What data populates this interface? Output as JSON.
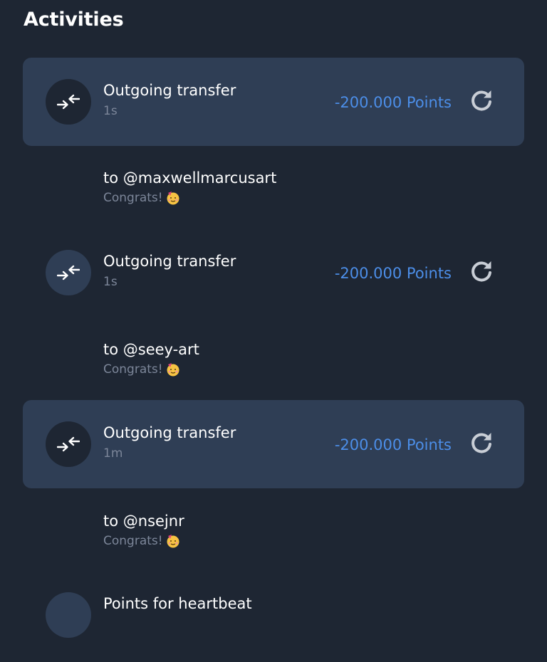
{
  "header": {
    "title": "Activities"
  },
  "activities": [
    {
      "title": "Outgoing transfer",
      "time": "1s",
      "amount": "-200.000 Points",
      "to": "to @maxwellmarcusart",
      "memo": "Congrats!"
    },
    {
      "title": "Outgoing transfer",
      "time": "1s",
      "amount": "-200.000 Points",
      "to": "to @seey-art",
      "memo": "Congrats!"
    },
    {
      "title": "Outgoing transfer",
      "time": "1m",
      "amount": "-200.000 Points",
      "to": "to @nsejnr",
      "memo": "Congrats!"
    },
    {
      "title": "Points for heartbeat"
    }
  ],
  "icons": {
    "transfer": "transfer-arrows-icon",
    "retry": "refresh-icon",
    "emoji": "partying-face-emoji"
  },
  "colors": {
    "background": "#1e2633",
    "card": "#2f3e55",
    "amount": "#4c8ee8",
    "muted": "#7c8699"
  }
}
